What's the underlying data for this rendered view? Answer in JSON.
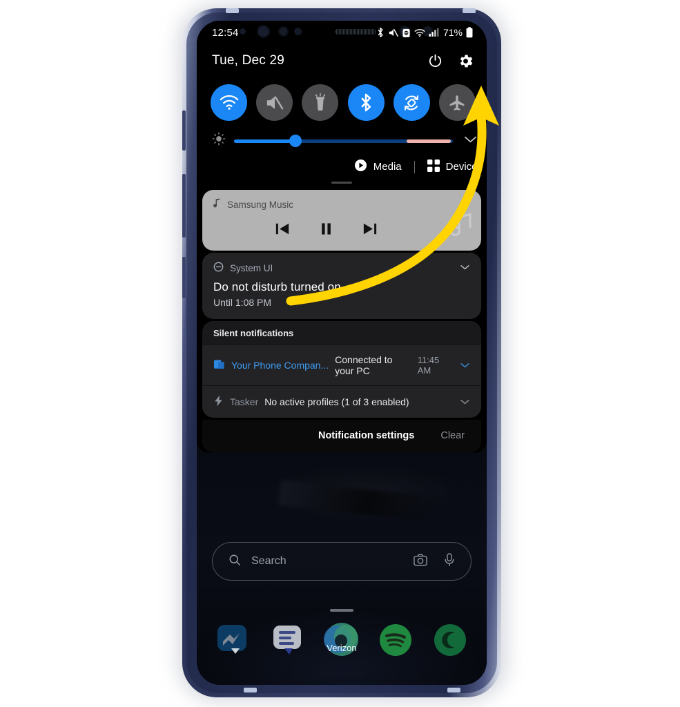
{
  "device": {
    "name": "samsung-galaxy-phone",
    "frame_color": "#2b3458",
    "accent": "#1b87f7",
    "annotation_color": "#ffd400"
  },
  "status_bar": {
    "clock": "12:54",
    "battery_percent": "71%",
    "icons": [
      "bluetooth-icon",
      "mute-icon",
      "dnd-lock-icon",
      "wifi-icon",
      "signal-icon",
      "battery-icon"
    ]
  },
  "panel_header": {
    "date": "Tue, Dec 29",
    "power_icon": "power-icon",
    "settings_icon": "gear-icon"
  },
  "quick_settings": {
    "toggles": [
      {
        "name": "wifi",
        "label": "Wi-Fi",
        "state": "on"
      },
      {
        "name": "sound",
        "label": "Mute",
        "state": "off"
      },
      {
        "name": "flashlight",
        "label": "Flashlight",
        "state": "off"
      },
      {
        "name": "bluetooth",
        "label": "Bluetooth",
        "state": "on"
      },
      {
        "name": "auto-rotate",
        "label": "Auto rotate",
        "state": "on"
      },
      {
        "name": "airplane-mode",
        "label": "Airplane mode",
        "state": "off"
      }
    ],
    "brightness": {
      "icon": "brightness-icon",
      "value_percent": 28,
      "pink_segment_start_percent": 79,
      "pink_segment_end_percent": 99,
      "expand_icon": "chevron-down-icon"
    },
    "media_button": "Media",
    "devices_button": "Devices"
  },
  "notifications": {
    "media": {
      "app": "Samsung Music",
      "app_icon": "music-note-icon",
      "controls": [
        "previous-icon",
        "pause-icon",
        "next-icon"
      ],
      "expand_icon": "chevron-down-icon"
    },
    "dnd": {
      "app": "System UI",
      "app_icon": "do-not-disturb-icon",
      "title": "Do not disturb turned on",
      "subtitle": "Until 1:08 PM",
      "expand_icon": "chevron-down-icon"
    },
    "silent_header": "Silent notifications",
    "silent_items": [
      {
        "app": "Your Phone Compan...",
        "app_icon": "your-phone-companion-icon",
        "body": "Connected to your PC",
        "time": "11:45 AM",
        "app_color": "#3d9bf0"
      },
      {
        "app": "Tasker",
        "app_icon": "tasker-bolt-icon",
        "body": "No active profiles (1 of 3 enabled)",
        "time": "",
        "app_color": "#8e949e"
      }
    ],
    "footer": {
      "settings_label": "Notification settings",
      "clear_label": "Clear"
    }
  },
  "home": {
    "search": {
      "placeholder": "Search",
      "search_icon": "search-icon",
      "lens_icon": "camera-icon",
      "mic_icon": "microphone-icon"
    },
    "dock": [
      {
        "name": "messenger",
        "label": ""
      },
      {
        "name": "messages",
        "label": ""
      },
      {
        "name": "verizon",
        "label": "Verizon"
      },
      {
        "name": "spotify",
        "label": ""
      },
      {
        "name": "cricket",
        "label": ""
      }
    ]
  }
}
